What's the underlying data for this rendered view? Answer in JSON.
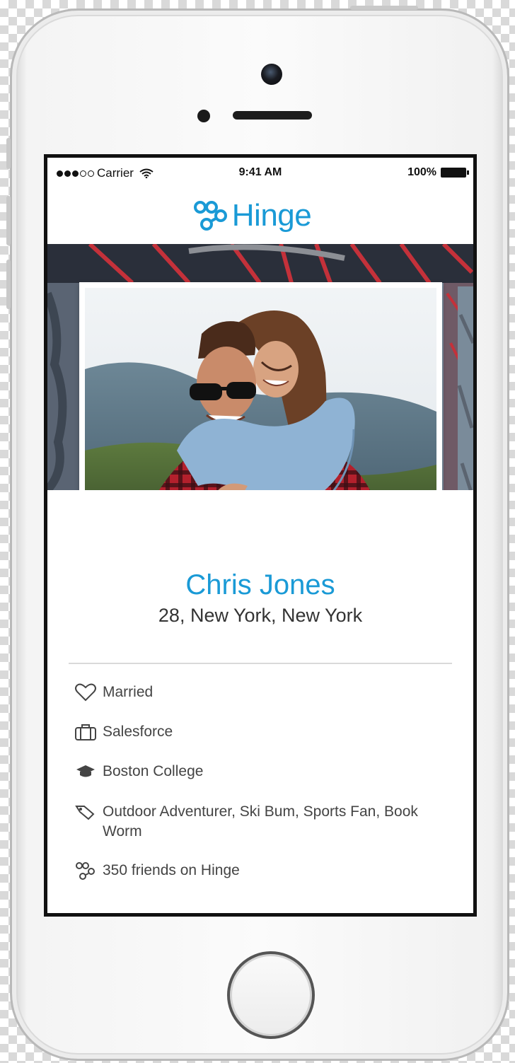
{
  "status_bar": {
    "carrier": "Carrier",
    "time": "9:41 AM",
    "battery": "100%"
  },
  "header": {
    "brand": "Hinge",
    "logo_icon": "hinge-logo-icon"
  },
  "profile": {
    "name": "Chris Jones",
    "location": "28, New York, New York"
  },
  "details": [
    {
      "icon": "heart-icon",
      "text": "Married"
    },
    {
      "icon": "briefcase-icon",
      "text": "Salesforce"
    },
    {
      "icon": "graduation-cap-icon",
      "text": "Boston College"
    },
    {
      "icon": "tag-icon",
      "text": "Outdoor Adventurer, Ski Bum, Sports Fan, Book Worm"
    },
    {
      "icon": "hinge-friends-icon",
      "text": "350 friends on Hinge"
    }
  ],
  "colors": {
    "accent": "#1a9ad6",
    "text": "#333333"
  }
}
